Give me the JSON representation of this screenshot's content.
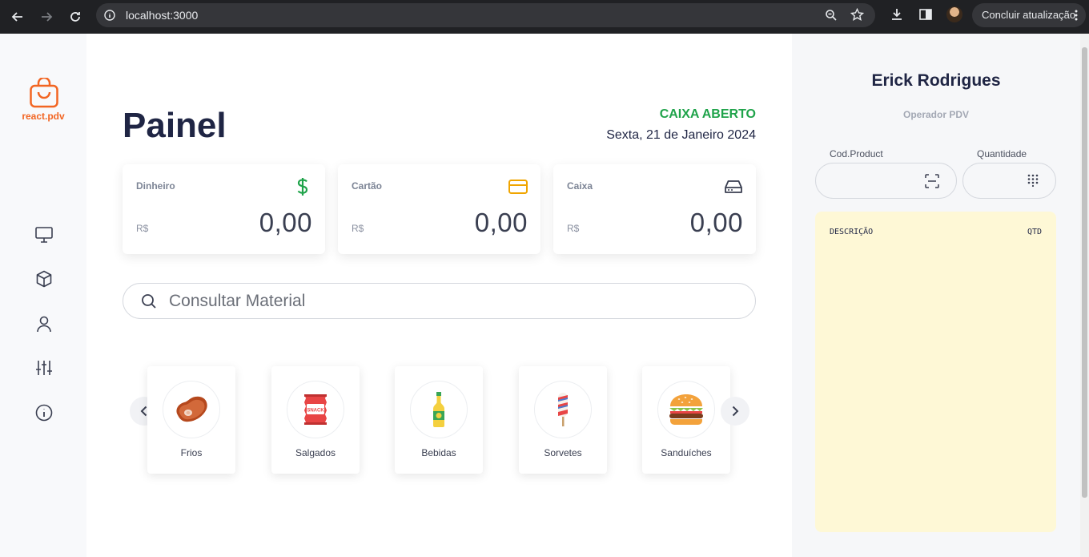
{
  "browser": {
    "url": "localhost:3000",
    "update_label": "Concluir atualização"
  },
  "sidebar": {
    "logo_text": "react.pdv",
    "items": [
      {
        "icon": "monitor-icon"
      },
      {
        "icon": "box-icon"
      },
      {
        "icon": "user-icon"
      },
      {
        "icon": "sliders-icon"
      },
      {
        "icon": "info-icon"
      }
    ]
  },
  "main": {
    "title": "Painel",
    "status": "CAIXA ABERTO",
    "date": "Sexta, 21 de Janeiro 2024",
    "cards": [
      {
        "title": "Dinheiro",
        "currency": "R$",
        "value": "0,00",
        "icon": "dollar-icon",
        "color": "#1fa34a"
      },
      {
        "title": "Cartão",
        "currency": "R$",
        "value": "0,00",
        "icon": "credit-card-icon",
        "color": "#f0a500"
      },
      {
        "title": "Caixa",
        "currency": "R$",
        "value": "0,00",
        "icon": "drive-icon",
        "color": "#3a3f51"
      }
    ],
    "search_placeholder": "Consultar Material",
    "categories": [
      {
        "label": "Frios",
        "icon": "steak-icon"
      },
      {
        "label": "Salgados",
        "icon": "snack-bag-icon"
      },
      {
        "label": "Bebidas",
        "icon": "bottle-icon"
      },
      {
        "label": "Sorvetes",
        "icon": "popsicle-icon"
      },
      {
        "label": "Sanduíches",
        "icon": "burger-icon"
      }
    ],
    "snack_text": "SNACK"
  },
  "right": {
    "user_name": "Erick Rodrigues",
    "user_role": "Operador PDV",
    "code_label": "Cod.Product",
    "qty_label": "Quantidade",
    "list_desc": "DESCRIÇÃO",
    "list_qty": "QTD"
  }
}
